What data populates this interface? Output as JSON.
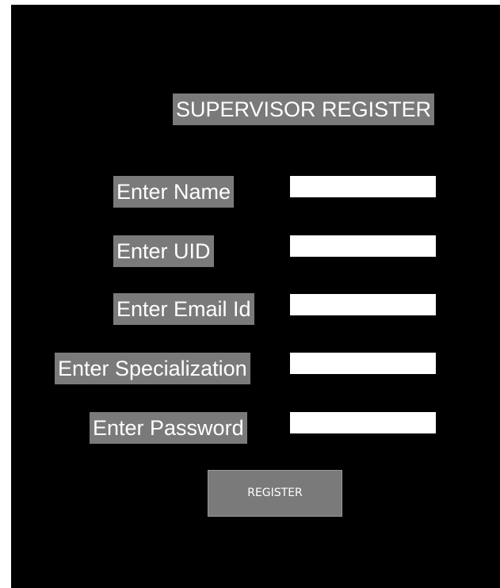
{
  "form": {
    "title": "SUPERVISOR REGISTER",
    "fields": [
      {
        "label": "Enter Name",
        "value": ""
      },
      {
        "label": "Enter UID",
        "value": ""
      },
      {
        "label": "Enter Email Id",
        "value": ""
      },
      {
        "label": "Enter Specialization",
        "value": ""
      },
      {
        "label": "Enter Password",
        "value": ""
      }
    ],
    "register_label": "REGISTER"
  },
  "colors": {
    "background": "#000000",
    "label_background": "#7a7a7a",
    "label_text": "#ffffff",
    "field_background": "#ffffff"
  }
}
